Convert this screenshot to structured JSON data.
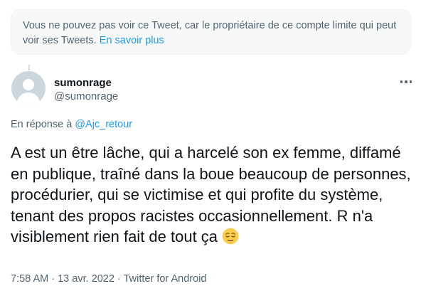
{
  "notice": {
    "text": "Vous ne pouvez pas voir ce Tweet, car le propriétaire de ce compte limite qui peut voir ses Tweets.",
    "link_text": "En savoir plus"
  },
  "author": {
    "display_name": "sumonrage",
    "handle": "@sumonrage"
  },
  "reply": {
    "prefix": "En réponse à",
    "mention": "@Ajc_retour"
  },
  "tweet": {
    "text": "A est un être lâche, qui a harcelé son ex femme, diffamé en publique, traîné dans la boue beaucoup de personnes, procédurier, qui se victimise et qui profite du système, tenant des propos racistes occasionnellement. R n'a visiblement rien fait de tout ça",
    "emoji": "relieved-face"
  },
  "meta": {
    "time": "7:58 AM",
    "separator": "·",
    "date": "13 avr. 2022",
    "source": "Twitter for Android"
  },
  "colors": {
    "link": "#1d9bf0",
    "secondary_text": "#536471",
    "primary_text": "#0f1419"
  }
}
